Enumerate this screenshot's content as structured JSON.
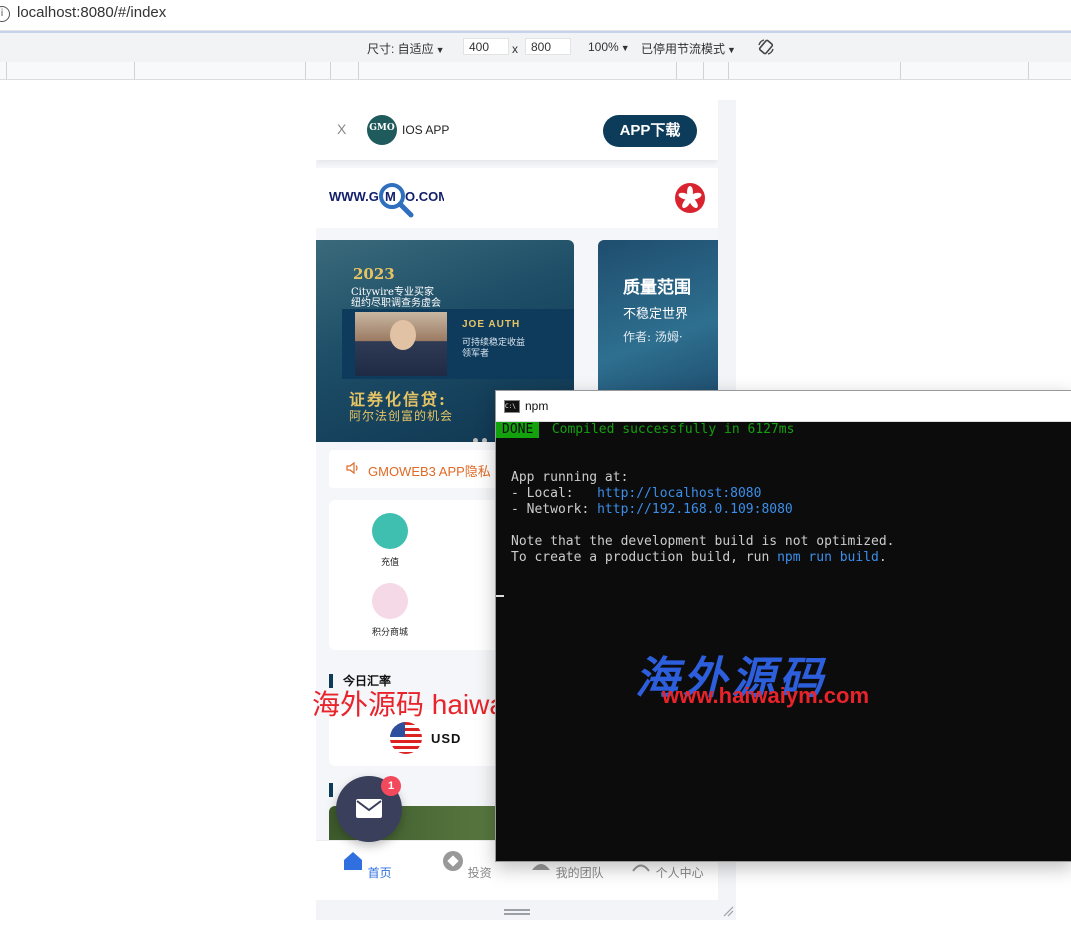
{
  "browser": {
    "url": "localhost:8080/#/index"
  },
  "devtools": {
    "size_label": "尺寸: 自适应",
    "width": "400",
    "x_label": "x",
    "height": "800",
    "zoom": "100%",
    "throttle": "已停用节流模式"
  },
  "app_banner": {
    "close": "X",
    "logo_text": "GMO",
    "app_name": "IOS APP",
    "download_label": "APP下载"
  },
  "site_logo": "WWW.GMO.COM",
  "carousel": {
    "slide1": {
      "year": "2023",
      "line1": "Citywire专业买家",
      "line2": "纽约尽职调查务虚会",
      "person": "JOE AUTH",
      "desc1": "可持续稳定收益",
      "desc2": "领军者",
      "title": "证券化信贷:",
      "subtitle": "阿尔法创富的机会"
    },
    "slide2": {
      "title": "质量范围",
      "subtitle": "不稳定世界",
      "author": "作者: 汤姆·"
    }
  },
  "notice": {
    "text": "GMOWEB3 APP隐私"
  },
  "menu": [
    {
      "label": "充值",
      "icon": "recharge-icon"
    },
    {
      "label": "积分商城",
      "icon": "points-mall-icon"
    }
  ],
  "exchange": {
    "title": "今日汇率",
    "currency": "USD"
  },
  "message_badge": "1",
  "tabs": [
    {
      "label": "首页",
      "icon": "home-icon"
    },
    {
      "label": "投资",
      "icon": "invest-icon"
    },
    {
      "label": "我的团队",
      "icon": "team-icon"
    },
    {
      "label": "个人中心",
      "icon": "profile-icon"
    }
  ],
  "terminal": {
    "title": "npm",
    "done": "DONE",
    "compiled": " Compiled successfully in 6127ms",
    "running": "App running at:",
    "local_label": "- Local:   ",
    "local_url": "http://localhost:8080",
    "network_label": "- Network: ",
    "network_url": "http://192.168.0.109:8080",
    "note1": "Note that the development build is not optimized.",
    "note2_prefix": "To create a production build, run ",
    "note2_cmd": "npm run build",
    "note2_suffix": "."
  },
  "watermarks": {
    "red_text": "海外源码 haiwaiym.com",
    "blue_text": "海外源码",
    "url": "www.haiwaiym.com"
  },
  "colors": {
    "accent": "#0d3b5a",
    "active_tab": "#2f6fe0",
    "notice": "#e06a25",
    "terminal_green": "#13a10e",
    "terminal_link": "#3b8eea"
  }
}
